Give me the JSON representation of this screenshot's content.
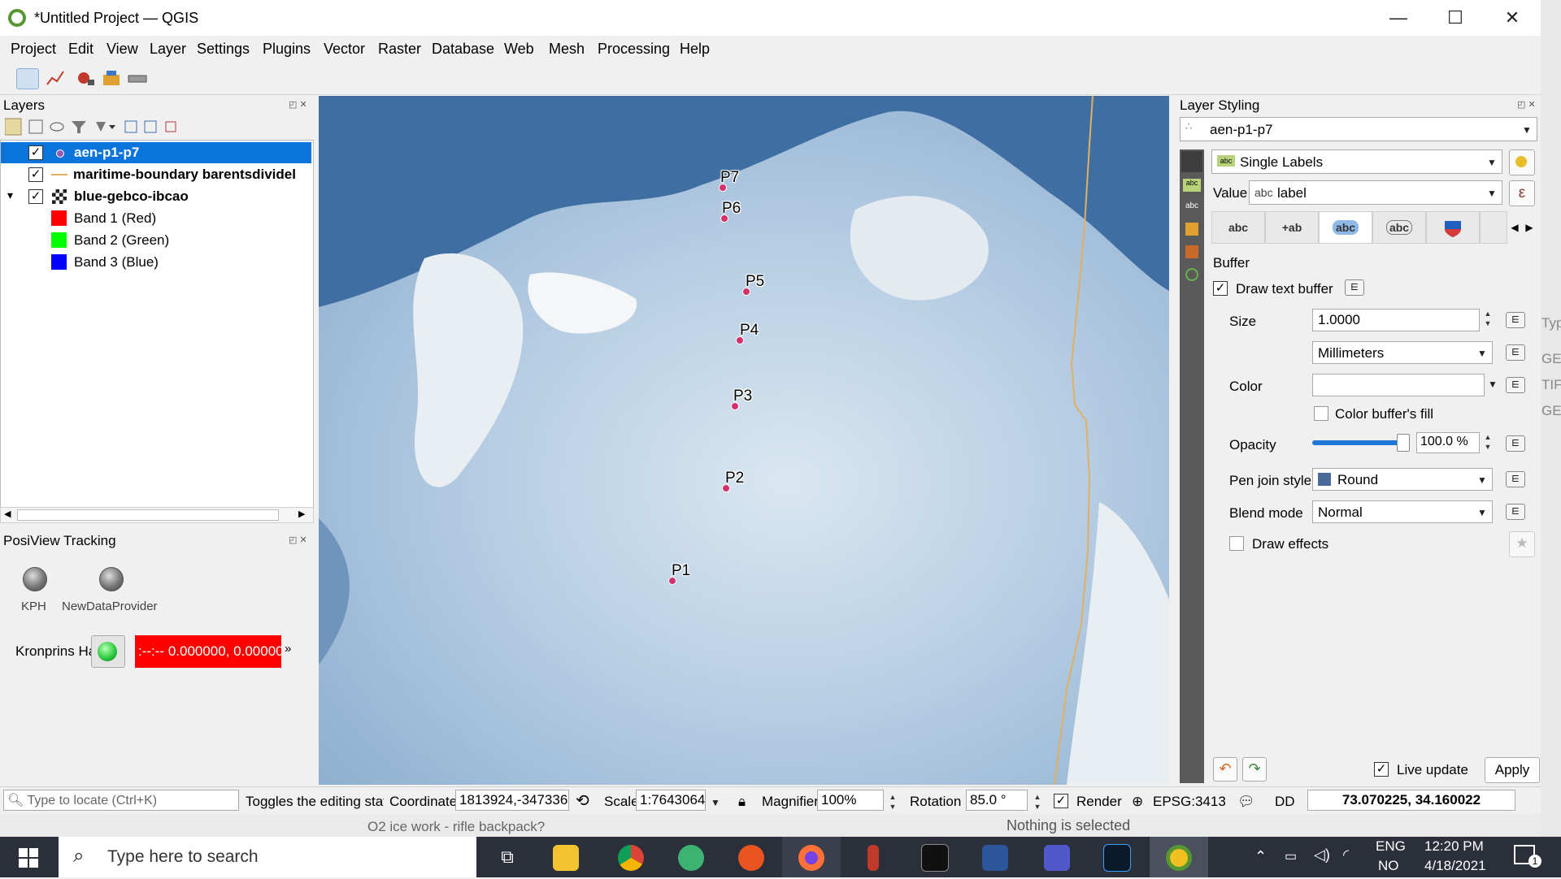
{
  "window": {
    "title": "*Untitled Project — QGIS",
    "minimize": "—",
    "maximize": "☐",
    "close": "✕"
  },
  "menu": [
    "Project",
    "Edit",
    "View",
    "Layer",
    "Settings",
    "Plugins",
    "Vector",
    "Raster",
    "Database",
    "Web",
    "Mesh",
    "Processing",
    "Help"
  ],
  "layers_panel": {
    "title": "Layers",
    "items": [
      {
        "name": "aen-p1-p7",
        "checked": "✓"
      },
      {
        "name": "maritime-boundary barentsdividel",
        "checked": "✓"
      },
      {
        "name": "blue-gebco-ibcao",
        "checked": "✓",
        "expand": "▾"
      }
    ],
    "bands": [
      {
        "name": "Band 1 (Red)",
        "color": "#ff0000"
      },
      {
        "name": "Band 2 (Green)",
        "color": "#00ff00"
      },
      {
        "name": "Band 3 (Blue)",
        "color": "#0000ff"
      }
    ]
  },
  "posiview": {
    "title": "PosiView Tracking",
    "providers": [
      "KPH",
      "NewDataProvider"
    ],
    "vessel": "Kronprins Ha",
    "position": ":--:-- 0.000000, 0.00000",
    "more": "»"
  },
  "map": {
    "points": [
      "P7",
      "P6",
      "P5",
      "P4",
      "P3",
      "P2",
      "P1"
    ]
  },
  "styling": {
    "title": "Layer Styling",
    "layer": "aen-p1-p7",
    "mode": "Single Labels",
    "value_label": "Value",
    "value": "label",
    "value_prefix": "abc",
    "tabs": [
      "abc",
      "+ab\n<c",
      "abc",
      "abc"
    ],
    "section": "Buffer",
    "draw_text_buffer": "Draw text buffer",
    "size_label": "Size",
    "size_value": "1.0000",
    "units": "Millimeters",
    "color_label": "Color",
    "color_fill": "Color buffer's fill",
    "opacity_label": "Opacity",
    "opacity_value": "100.0 %",
    "opacity_level": 1.0,
    "pen_join_label": "Pen join style",
    "pen_join": "Round",
    "blend_label": "Blend mode",
    "blend": "Normal",
    "draw_effects": "Draw effects",
    "live_update": "Live update",
    "apply": "Apply"
  },
  "statusbar": {
    "locate_placeholder": "Type to locate (Ctrl+K)",
    "editing_msg": "Toggles the editing stat",
    "coordinate_label": "Coordinate",
    "coordinate": "1813924,-347336",
    "scale_label": "Scale",
    "scale": "1:7643064",
    "magnifier_label": "Magnifier",
    "magnifier": "100%",
    "rotation_label": "Rotation",
    "rotation": "85.0 °",
    "render_label": "Render",
    "crs": "EPSG:3413",
    "dd": "DD",
    "dd_value": "73.070225, 34.160022"
  },
  "behind": {
    "row_text": "O2 ice work - rifle backpack?",
    "nothing_selected": "Nothing is selected",
    "side_bits": [
      "Typ",
      "GE(",
      "TIF",
      "GE("
    ]
  },
  "taskbar": {
    "search_placeholder": "Type here to search",
    "lang1": "ENG",
    "lang2": "NO",
    "time": "12:20 PM",
    "date": "4/18/2021",
    "notifications": "1"
  }
}
